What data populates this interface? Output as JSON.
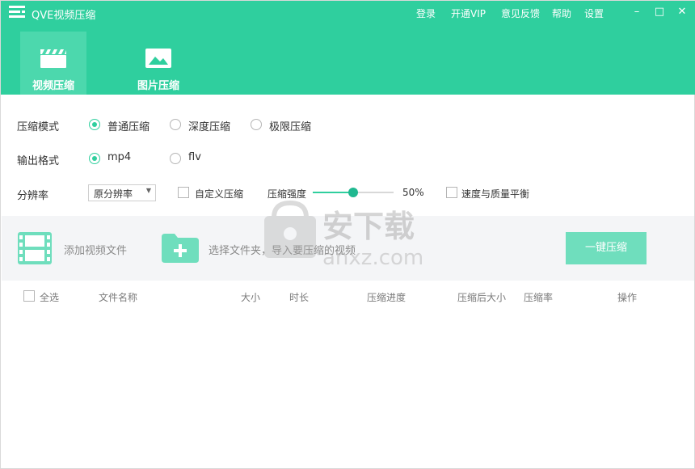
{
  "app": {
    "title": "QVE视频压缩"
  },
  "topmenu": {
    "login": "登录",
    "vip": "开通VIP",
    "feedback": "意见反馈",
    "help": "帮助",
    "settings": "设置"
  },
  "window_controls": {
    "minimize": "–",
    "maximize": "□",
    "close": "✕"
  },
  "tabs": [
    {
      "label": "视频压缩",
      "icon": "clapperboard-icon",
      "active": true
    },
    {
      "label": "图片压缩",
      "icon": "image-icon",
      "active": false
    }
  ],
  "settings": {
    "mode_label": "压缩模式",
    "modes": [
      "普通压缩",
      "深度压缩",
      "极限压缩"
    ],
    "mode_selected": "普通压缩",
    "format_label": "输出格式",
    "formats": [
      "mp4",
      "flv"
    ],
    "format_selected": "mp4",
    "resolution_label": "分辨率",
    "resolution_value": "原分辨率",
    "custom_label": "自定义压缩",
    "strength_label": "压缩强度",
    "strength_value": "50%",
    "strength_fraction": 0.5,
    "balance_label": "速度与质量平衡"
  },
  "toolbar": {
    "add_video": "添加视频文件",
    "select_folder": "选择文件夹，导入要压缩的视频",
    "compress_button": "一键压缩"
  },
  "watermark": {
    "text": "安下载",
    "domain": "anxz.com"
  },
  "table": {
    "select_all": "全选",
    "columns": [
      "文件名称",
      "大小",
      "时长",
      "压缩进度",
      "压缩后大小",
      "压缩率",
      "操作"
    ],
    "rows": []
  },
  "colors": {
    "accent": "#2fcf9e",
    "active_tab": "#4cd8ad",
    "button": "#6fdebd"
  }
}
